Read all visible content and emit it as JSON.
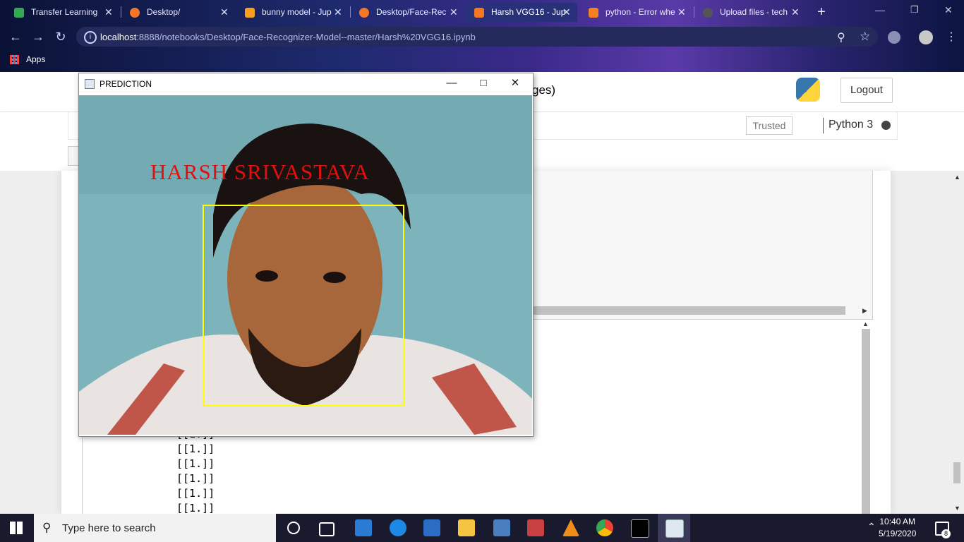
{
  "tabs": [
    {
      "label": "Transfer Learning",
      "color": "#34a853"
    },
    {
      "label": "Desktop/",
      "color": "#f37726"
    },
    {
      "label": "bunny model - Jup",
      "color": "#f8a01e"
    },
    {
      "label": "Desktop/Face-Rec",
      "color": "#f37726"
    },
    {
      "label": "Harsh VGG16 - Jup",
      "color": "#f37726"
    },
    {
      "label": "python - Error whe",
      "color": "#f48024"
    },
    {
      "label": "Upload files - tech",
      "color": "#555555"
    }
  ],
  "close_glyph": "✕",
  "new_tab_glyph": "+",
  "url": {
    "host": "localhost",
    "rest": ":8888/notebooks/Desktop/Face-Recognizer-Model--master/Harsh%20VGG16.ipynb"
  },
  "bookmarks": {
    "apps": "Apps"
  },
  "jupyter": {
    "title_fragment": "ges)",
    "logout": "Logout",
    "trusted": "Trusted",
    "kernel": "Python 3",
    "output_lines": [
      "[[1.]]",
      "[[1.]]",
      "[[1.]]",
      "[[1.]]",
      "[[1.]]",
      "[[1.]]"
    ]
  },
  "prediction_window": {
    "title": "PREDICTION",
    "label": "HARSH SRIVASTAVA"
  },
  "taskbar": {
    "search_placeholder": "Type here to search",
    "time": "10:40 AM",
    "date": "5/19/2020",
    "notifications": "8"
  }
}
